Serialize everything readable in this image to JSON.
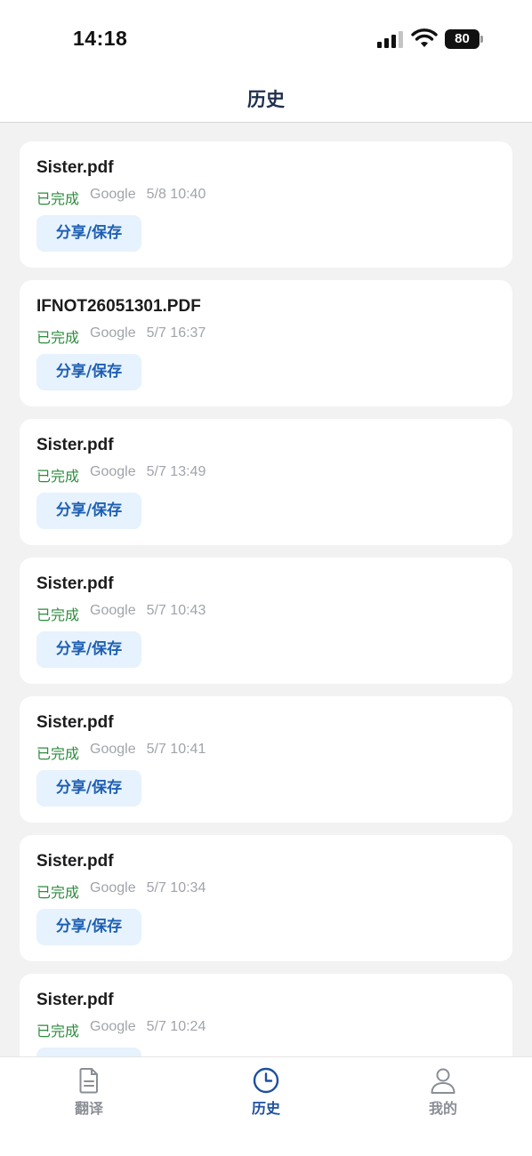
{
  "status_bar": {
    "time": "14:18",
    "battery": "80"
  },
  "nav": {
    "title": "历史"
  },
  "history": {
    "share_label": "分享/保存",
    "items": [
      {
        "file": "Sister.pdf",
        "status": "已完成",
        "engine": "Google",
        "time": "5/8 10:40"
      },
      {
        "file": "IFNOT26051301.PDF",
        "status": "已完成",
        "engine": "Google",
        "time": "5/7 16:37"
      },
      {
        "file": "Sister.pdf",
        "status": "已完成",
        "engine": "Google",
        "time": "5/7 13:49"
      },
      {
        "file": "Sister.pdf",
        "status": "已完成",
        "engine": "Google",
        "time": "5/7 10:43"
      },
      {
        "file": "Sister.pdf",
        "status": "已完成",
        "engine": "Google",
        "time": "5/7 10:41"
      },
      {
        "file": "Sister.pdf",
        "status": "已完成",
        "engine": "Google",
        "time": "5/7 10:34"
      },
      {
        "file": "Sister.pdf",
        "status": "已完成",
        "engine": "Google",
        "time": "5/7 10:24"
      }
    ]
  },
  "tabs": [
    {
      "label": "翻译",
      "icon": "document-icon",
      "active": false
    },
    {
      "label": "历史",
      "icon": "clock-icon",
      "active": true
    },
    {
      "label": "我的",
      "icon": "person-icon",
      "active": false
    }
  ],
  "colors": {
    "accent": "#1e4fa0",
    "status_done": "#2e8b3e",
    "share_bg": "#e6f2fd"
  }
}
